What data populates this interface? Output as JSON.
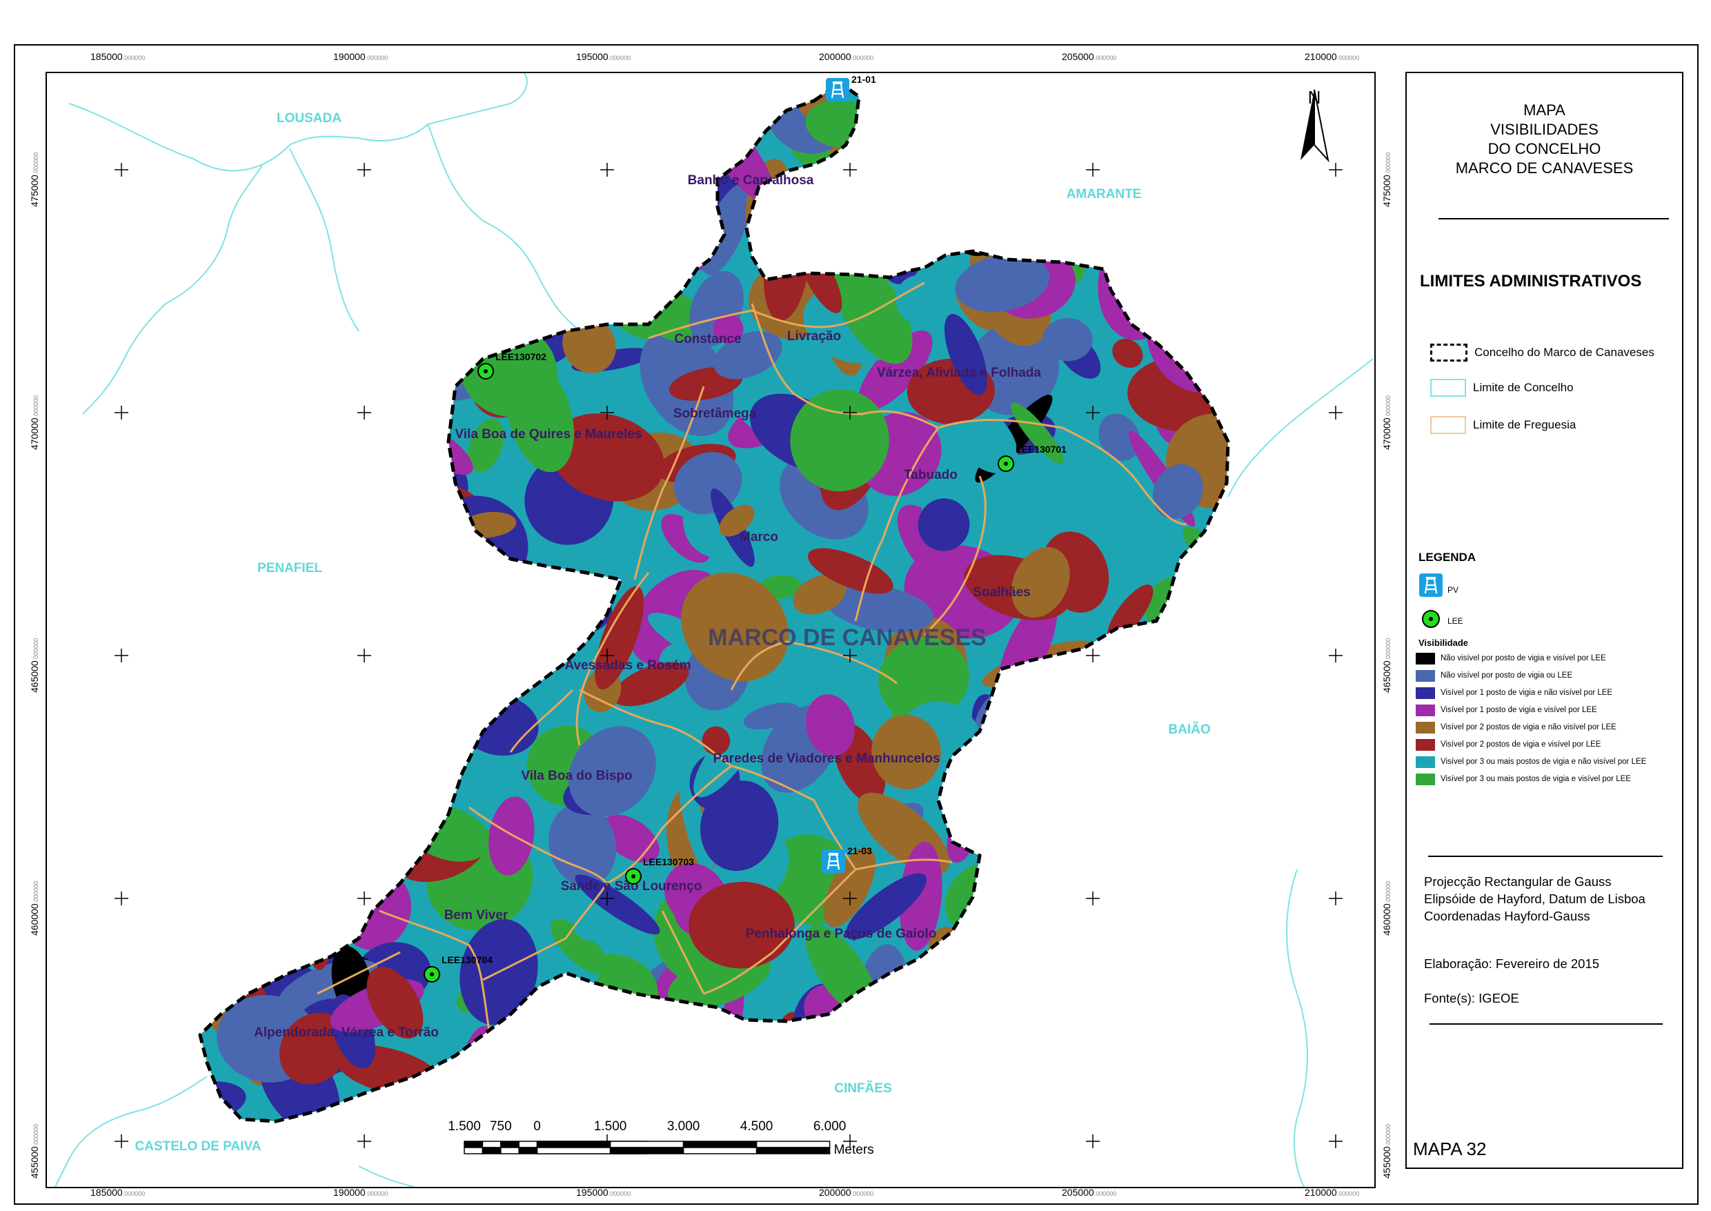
{
  "map": {
    "grid_x_labels": [
      "185000",
      "190000",
      "195000",
      "200000",
      "205000",
      "210000"
    ],
    "grid_y_labels": [
      "475000",
      "470000",
      "465000",
      "460000",
      "455000"
    ],
    "tick_suffix": ".000000",
    "north_label": "N",
    "municipality_label": "MARCO DE CANAVESES",
    "neighbor_labels": [
      "LOUSADA",
      "AMARANTE",
      "PENAFIEL",
      "BAIÃO",
      "CINFÃES",
      "CASTELO DE PAIVA"
    ],
    "parish_labels": [
      "Banho e Carvalhosa",
      "Constance",
      "Livração",
      "Várzea, Aliviada e Folhada",
      "Sobretâmega",
      "Vila Boa de Quires e Maureles",
      "Tabuado",
      "Marco",
      "Soalhães",
      "Avessadas e Rosém",
      "Paredes de Viadores e Manhuncelos",
      "Vila Boa do Bispo",
      "Sande e São Lourenço",
      "Bem Viver",
      "Penhalonga e Paços de Gaiolo",
      "Alpendorada, Várzea e Torrão"
    ],
    "lee_points": [
      "LEE130702",
      "LEE130701",
      "LEE130703",
      "LEE130704"
    ],
    "pv_points": [
      "21-01",
      "21-03"
    ],
    "scalebar": {
      "labels": [
        "1.500",
        "750",
        "0",
        "1.500",
        "3.000",
        "4.500",
        "6.000"
      ],
      "unit": "Meters"
    }
  },
  "panel": {
    "title": [
      "MAPA",
      "VISIBILIDADES",
      "DO CONCELHO",
      "MARCO DE CANAVESES"
    ],
    "admin_heading": "LIMITES ADMINISTRATIVOS",
    "admin_items": [
      "Concelho do Marco de Canaveses",
      "Limite de Concelho",
      "Limite de Freguesia"
    ],
    "legend_heading": "LEGENDA",
    "pv_label": "PV",
    "lee_label": "LEE",
    "visibility_heading": "Visibilidade",
    "visibility_classes": [
      {
        "label": "Não visível por posto de vigia e visível por LEE",
        "color": "#000000"
      },
      {
        "label": "Não visível por posto de vigia ou LEE",
        "color": "#4a68b0"
      },
      {
        "label": "Visível por 1 posto de vigia e não visível por LEE",
        "color": "#2e2c9e"
      },
      {
        "label": "Visível por 1 posto de vigia e visível por LEE",
        "color": "#a02aa8"
      },
      {
        "label": "Visível por 2 postos de vigia e não visível por LEE",
        "color": "#9a6a2a"
      },
      {
        "label": "Visível por 2 postos de vigia e visível por LEE",
        "color": "#9c2326"
      },
      {
        "label": "Visível por 3 ou mais postos de vigia e não visível por LEE",
        "color": "#1ea5b4"
      },
      {
        "label": "Visível por 3 ou mais postos de vigia e visível por LEE",
        "color": "#33a83a"
      }
    ],
    "projection": [
      "Projecção Rectangular de Gauss",
      "Elipsóide de Hayford, Datum de Lisboa",
      "Coordenadas Hayford-Gauss"
    ],
    "elaboration": "Elaboração: Fevereiro de 2015",
    "source": "Fonte(s): IGEOE",
    "map_number": "MAPA 32"
  },
  "colors": {
    "concelho_limit": "#7ee3e3",
    "freguesia_limit": "#e8a85a",
    "lee_marker": "#22dd22",
    "pv_marker": "#1aa0e0",
    "neighbor_text": "#5fd8d8",
    "parish_text": "#3a1a66"
  }
}
